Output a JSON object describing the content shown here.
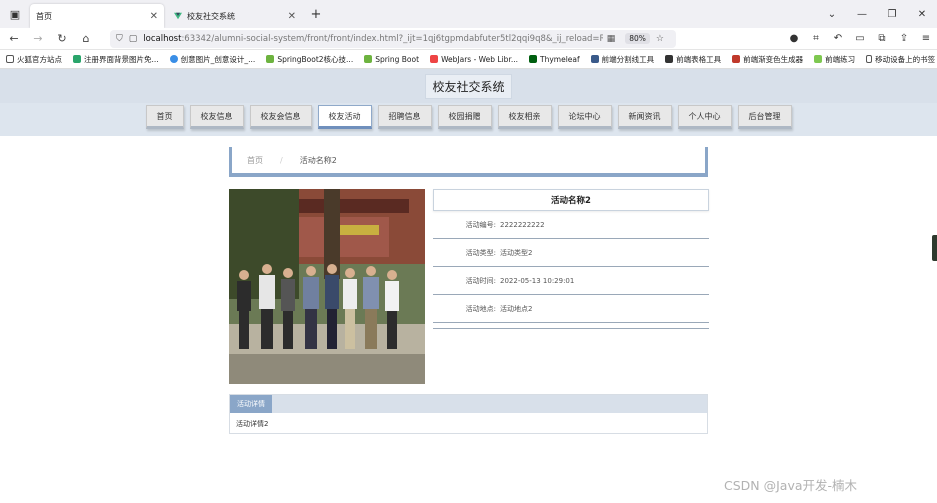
{
  "browser": {
    "tabs": [
      {
        "title": "首页",
        "active": true
      },
      {
        "title": "校友社交系统",
        "active": false
      }
    ],
    "url_host": "localhost",
    "url_path": ":63342/alumni-social-system/front/front/index.html?_ijt=1qj6tgpmdabfuter5tl2qqi9q8&_ij_reload=RELOA",
    "zoom": "80%",
    "bookmarks": [
      "火狐官方站点",
      "注册界面背景图片免...",
      "创意图片_创意设计_...",
      "SpringBoot2核心技...",
      "Spring Boot",
      "WebJars - Web Libr...",
      "Thymeleaf",
      "前端分割线工具",
      "前端表格工具",
      "前端渐变色生成器",
      "前端练习"
    ],
    "bookmarks_right": "移动设备上的书签"
  },
  "site": {
    "title": "校友社交系统",
    "menu": [
      "首页",
      "校友信息",
      "校友会信息",
      "校友活动",
      "招聘信息",
      "校园捐赠",
      "校友相亲",
      "论坛中心",
      "新闻资讯",
      "个人中心",
      "后台管理"
    ],
    "active_menu": "校友活动",
    "breadcrumb": {
      "home": "首页",
      "sep": "/",
      "current": "活动名称2"
    }
  },
  "activity": {
    "title": "活动名称2",
    "fields": [
      {
        "label": "活动编号:",
        "value": "2222222222"
      },
      {
        "label": "活动类型:",
        "value": "活动类型2"
      },
      {
        "label": "活动时间:",
        "value": "2022-05-13 10:29:01"
      },
      {
        "label": "活动地点:",
        "value": "活动地点2"
      }
    ],
    "detail_tab": "活动详情",
    "detail_text": "活动详情2"
  },
  "watermark": "CSDN @Java开发-楠木"
}
